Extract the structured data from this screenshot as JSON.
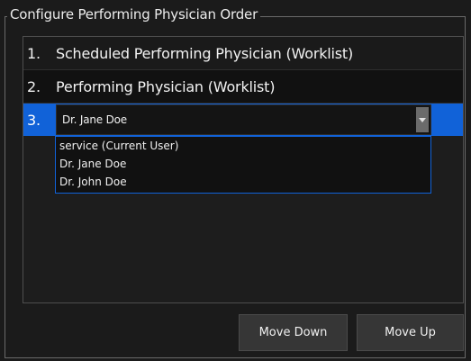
{
  "group": {
    "title": "Configure Performing Physician Order"
  },
  "list": {
    "rows": [
      {
        "index": "1.",
        "label": "Scheduled Performing Physician (Worklist)"
      },
      {
        "index": "2.",
        "label": "Performing Physician (Worklist)"
      },
      {
        "index": "3.",
        "selected_value": "Dr. Jane Doe"
      }
    ]
  },
  "dropdown": {
    "options": [
      "service (Current User)",
      "Dr. Jane Doe",
      "Dr. John Doe"
    ]
  },
  "buttons": {
    "move_down": "Move Down",
    "move_up": "Move Up"
  },
  "colors": {
    "selection": "#1162d8",
    "background": "#1b1b1b"
  },
  "icons": {
    "combo_arrow": "chevron-down-icon"
  }
}
